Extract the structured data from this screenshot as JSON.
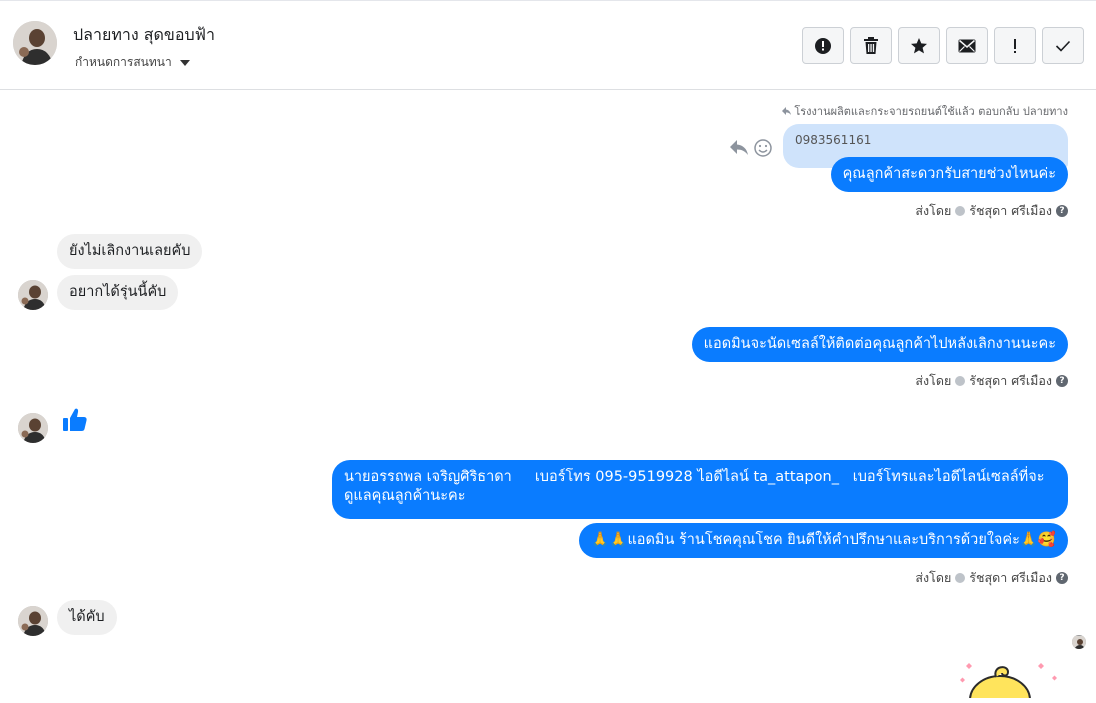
{
  "header": {
    "contact_name": "ปลายทาง สุดขอบฟ้า",
    "conversation_menu_label": "กำหนดการสนทนา"
  },
  "toolbar": {
    "buttons": [
      "alert-circle-icon",
      "trash-icon",
      "star-icon",
      "envelope-icon",
      "exclamation-icon",
      "check-icon"
    ]
  },
  "messages": {
    "reply_note": "โรงงานผลิตและกระจายรถยนต์ใช้แล้ว ตอบกลับ ปลายทาง",
    "quoted_text": "0983561161",
    "out_1": "คุณลูกค้าสะดวกรับสายช่วงไหนค่ะ",
    "in_1": "ยังไม่เลิกงานเลยคับ",
    "in_2": "อยากได้รุ่นนี้คับ",
    "out_2": "แอดมินจะนัดเซลล์ให้ติดต่อคุณลูกค้าไปหลังเลิกงานนะคะ",
    "out_3_line1": "นายอรรถพล เจริญศิริธาดา     เบอร์โทร 095-9519928 ไอดีไลน์ ta_attapon_   เบอร์โทรและไอดีไลน์เซลล์ที่จะ",
    "out_3_line2": "ดูแลคุณลูกค้านะคะ",
    "out_4": "🙏🙏แอดมิน ร้านโชคคุณโชค ยินดีให้คำปรึกษาและบริการด้วยใจค่ะ🙏🥰",
    "in_3": "ได้คับ"
  },
  "meta": {
    "sent_by": "ส่งโดย",
    "agent_name": "รัชสุดา ศรีเมือง",
    "help_mark": "?"
  },
  "colors": {
    "outgoing_bubble": "#0a7cff",
    "incoming_bubble": "#f0f0f0",
    "quoted_bubble": "#cfe3fb",
    "like_icon": "#0a7cff"
  }
}
